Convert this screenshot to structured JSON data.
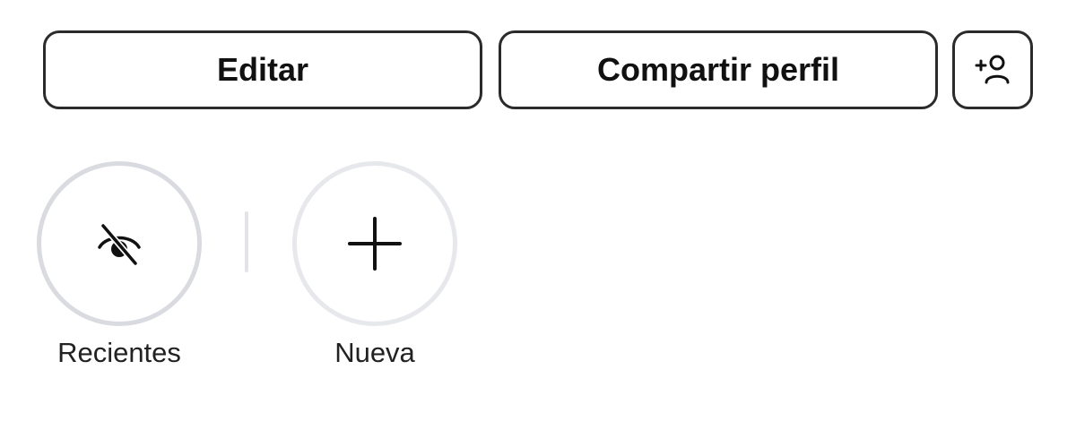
{
  "actions": {
    "edit_label": "Editar",
    "share_label": "Compartir perfil",
    "discover_people_icon": "add-person-icon"
  },
  "highlights": [
    {
      "label": "Recientes",
      "icon": "eye-off-icon"
    },
    {
      "label": "Nueva",
      "icon": "plus-icon"
    }
  ],
  "colors": {
    "text": "#111111",
    "button_border": "#2b2b2b",
    "ring_recent": "#d9dbe1",
    "ring_new": "#e7e8ec",
    "divider": "#e3e4e8"
  }
}
